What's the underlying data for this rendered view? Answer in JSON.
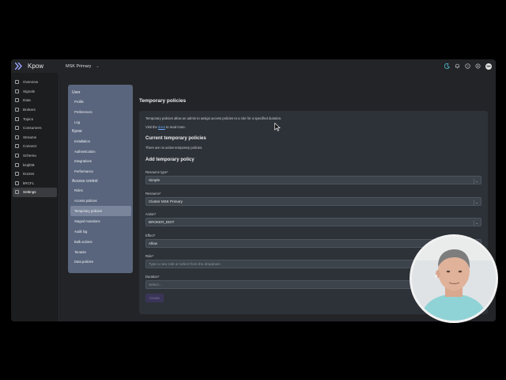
{
  "topbar": {
    "brand": "Kpow",
    "cluster": "MSK Primary",
    "avatar_initials": "DH"
  },
  "leftnav": {
    "items": [
      {
        "label": "Overview",
        "icon": "grid-icon"
      },
      {
        "label": "Signals",
        "icon": "pulse-icon"
      },
      {
        "label": "Data",
        "icon": "database-icon"
      },
      {
        "label": "Brokers",
        "icon": "server-icon"
      },
      {
        "label": "Topics",
        "icon": "layers-icon"
      },
      {
        "label": "Consumers",
        "icon": "users-icon"
      },
      {
        "label": "Streams",
        "icon": "stream-icon"
      },
      {
        "label": "Connect",
        "icon": "plug-icon"
      },
      {
        "label": "Schema",
        "icon": "schema-icon"
      },
      {
        "label": "ksqlDB",
        "icon": "sql-icon"
      },
      {
        "label": "Doctes",
        "icon": "doc-icon"
      },
      {
        "label": "kRCFL",
        "icon": "box-icon"
      },
      {
        "label": "Settings",
        "icon": "gear-icon"
      }
    ]
  },
  "settingsnav": {
    "user_group": "User",
    "user_items": [
      "Profile",
      "Preferences",
      "Log"
    ],
    "kpow_group": "Kpow",
    "kpow_items": [
      "Installation",
      "Authentication",
      "Integrations",
      "Performance"
    ],
    "access_group": "Access control",
    "access_items": [
      "Roles",
      "Access policies",
      "Temporary policies",
      "Staged mutations",
      "Audit log",
      "Bulk actions",
      "Tenants",
      "Data policies"
    ]
  },
  "content": {
    "title": "Temporary policies",
    "desc1": "Temporary policies allow an admin to assign access policies to a role for a specified duration.",
    "desc2_pre": "Visit the ",
    "desc2_link": "docs",
    "desc2_post": " to read more.",
    "current_heading": "Current temporary policies",
    "current_empty": "There are no active temporary policies.",
    "add_heading": "Add temporary policy",
    "fields": {
      "resource_type_label": "Resource type*",
      "resource_type_value": "Simple",
      "resource_label": "Resource*",
      "resource_value": "Cluster MSK Primary",
      "action_label": "Action*",
      "action_value": "BROKER_EDIT",
      "effect_label": "Effect*",
      "effect_value": "Allow",
      "role_label": "Role*",
      "role_placeholder": "Type a new role or select from the dropdown",
      "duration_label": "Duration*",
      "duration_placeholder": "Select..."
    },
    "create_label": "Create"
  },
  "colors": {
    "accent": "#6ea8ff",
    "settings_nav_bg": "#59657c",
    "card_bg": "#2d3238"
  }
}
